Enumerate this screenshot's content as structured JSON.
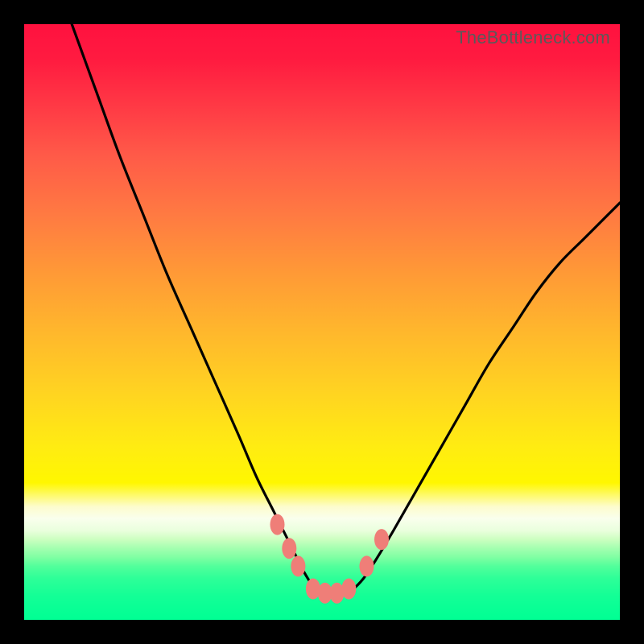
{
  "watermark": "TheBottleneck.com",
  "chart_data": {
    "type": "line",
    "title": "",
    "xlabel": "",
    "ylabel": "",
    "xlim": [
      0,
      100
    ],
    "ylim": [
      0,
      100
    ],
    "series": [
      {
        "name": "bottleneck-curve",
        "x": [
          8,
          12,
          16,
          20,
          24,
          28,
          32,
          36,
          39,
          42,
          45,
          47,
          49,
          51,
          53,
          55,
          57,
          59,
          62,
          66,
          70,
          74,
          78,
          82,
          86,
          90,
          94,
          98,
          100
        ],
        "values": [
          100,
          89,
          78,
          68,
          58,
          49,
          40,
          31,
          24,
          18,
          12,
          8,
          5,
          4,
          4,
          5,
          7,
          10,
          15,
          22,
          29,
          36,
          43,
          49,
          55,
          60,
          64,
          68,
          70
        ]
      }
    ],
    "markers": [
      {
        "name": "left-upper",
        "x": 42.5,
        "y": 16.0
      },
      {
        "name": "left-mid",
        "x": 44.5,
        "y": 12.0
      },
      {
        "name": "left-lower",
        "x": 46.0,
        "y": 9.0
      },
      {
        "name": "bottom-1",
        "x": 48.5,
        "y": 5.2
      },
      {
        "name": "bottom-2",
        "x": 50.5,
        "y": 4.5
      },
      {
        "name": "bottom-3",
        "x": 52.5,
        "y": 4.5
      },
      {
        "name": "bottom-4",
        "x": 54.5,
        "y": 5.2
      },
      {
        "name": "right-lower",
        "x": 57.5,
        "y": 9.0
      },
      {
        "name": "right-upper",
        "x": 60.0,
        "y": 13.5
      }
    ],
    "colors": {
      "curve_stroke": "#000000",
      "marker_fill": "#ef7e78"
    }
  }
}
